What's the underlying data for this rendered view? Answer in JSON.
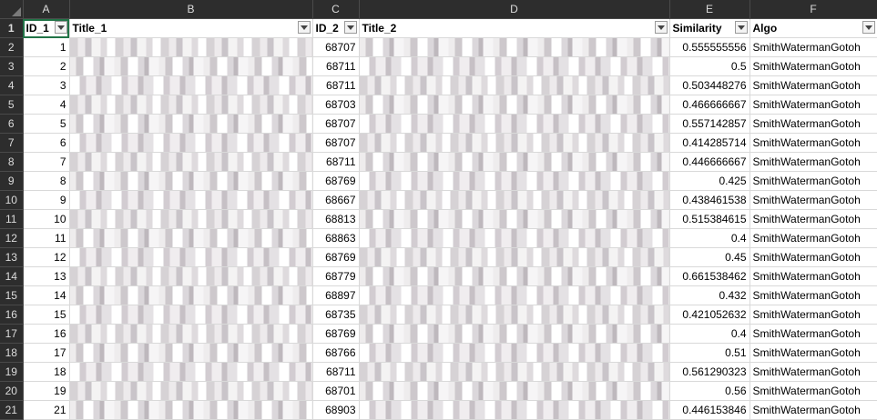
{
  "columns": [
    "A",
    "B",
    "C",
    "D",
    "E",
    "F"
  ],
  "row_numbers": [
    "1",
    "2",
    "3",
    "4",
    "5",
    "6",
    "7",
    "8",
    "9",
    "10",
    "11",
    "12",
    "13",
    "14",
    "15",
    "16",
    "17",
    "18",
    "19",
    "20",
    "21"
  ],
  "headers": {
    "id1": "ID_1",
    "title1": "Title_1",
    "id2": "ID_2",
    "title2": "Title_2",
    "similarity": "Similarity",
    "algo": "Algo"
  },
  "rows": [
    {
      "id1": "1",
      "id2": "68707",
      "similarity": "0.555555556",
      "algo": "SmithWatermanGotoh"
    },
    {
      "id1": "2",
      "id2": "68711",
      "similarity": "0.5",
      "algo": "SmithWatermanGotoh"
    },
    {
      "id1": "3",
      "id2": "68711",
      "similarity": "0.503448276",
      "algo": "SmithWatermanGotoh"
    },
    {
      "id1": "4",
      "id2": "68703",
      "similarity": "0.466666667",
      "algo": "SmithWatermanGotoh"
    },
    {
      "id1": "5",
      "id2": "68707",
      "similarity": "0.557142857",
      "algo": "SmithWatermanGotoh"
    },
    {
      "id1": "6",
      "id2": "68707",
      "similarity": "0.414285714",
      "algo": "SmithWatermanGotoh"
    },
    {
      "id1": "7",
      "id2": "68711",
      "similarity": "0.446666667",
      "algo": "SmithWatermanGotoh"
    },
    {
      "id1": "8",
      "id2": "68769",
      "similarity": "0.425",
      "algo": "SmithWatermanGotoh"
    },
    {
      "id1": "9",
      "id2": "68667",
      "similarity": "0.438461538",
      "algo": "SmithWatermanGotoh"
    },
    {
      "id1": "10",
      "id2": "68813",
      "similarity": "0.515384615",
      "algo": "SmithWatermanGotoh"
    },
    {
      "id1": "11",
      "id2": "68863",
      "similarity": "0.4",
      "algo": "SmithWatermanGotoh"
    },
    {
      "id1": "12",
      "id2": "68769",
      "similarity": "0.45",
      "algo": "SmithWatermanGotoh"
    },
    {
      "id1": "13",
      "id2": "68779",
      "similarity": "0.661538462",
      "algo": "SmithWatermanGotoh"
    },
    {
      "id1": "14",
      "id2": "68897",
      "similarity": "0.432",
      "algo": "SmithWatermanGotoh"
    },
    {
      "id1": "15",
      "id2": "68735",
      "similarity": "0.421052632",
      "algo": "SmithWatermanGotoh"
    },
    {
      "id1": "16",
      "id2": "68769",
      "similarity": "0.4",
      "algo": "SmithWatermanGotoh"
    },
    {
      "id1": "17",
      "id2": "68766",
      "similarity": "0.51",
      "algo": "SmithWatermanGotoh"
    },
    {
      "id1": "18",
      "id2": "68711",
      "similarity": "0.561290323",
      "algo": "SmithWatermanGotoh"
    },
    {
      "id1": "19",
      "id2": "68701",
      "similarity": "0.56",
      "algo": "SmithWatermanGotoh"
    },
    {
      "id1": "21",
      "id2": "68903",
      "similarity": "0.446153846",
      "algo": "SmithWatermanGotoh"
    }
  ],
  "icons": {
    "filter": "filter-dropdown-icon",
    "select_all": "select-all-triangle-icon"
  },
  "colors": {
    "header_bg": "#2d2d2d",
    "header_text": "#dcdcdc",
    "active_cell": "#217346",
    "gridline": "#d9d9d9"
  }
}
